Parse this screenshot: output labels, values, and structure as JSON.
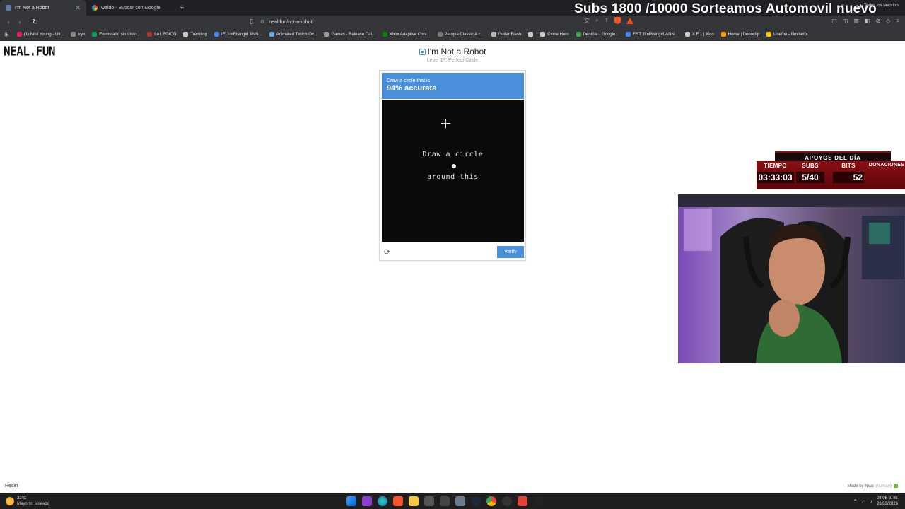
{
  "browser": {
    "tabs": [
      {
        "label": "I'm Not a Robot",
        "active": true
      },
      {
        "label": "waldo - Buscar con Google",
        "active": false
      }
    ],
    "url": "neal.fun/not-a-robot/",
    "bookmarks": [
      {
        "label": "(1) Nihil Young - Ult...",
        "color": "#e91e63"
      },
      {
        "label": "tryn",
        "color": "#888888"
      },
      {
        "label": "Formulario sin título...",
        "color": "#0f9d58"
      },
      {
        "label": "LA LEGION",
        "color": "#aa3333"
      },
      {
        "label": "Trending",
        "color": "#cccccc"
      },
      {
        "label": "IE JimRising#LANN...",
        "color": "#4285f4"
      },
      {
        "label": "Animated Twitch Ov...",
        "color": "#6fa8dc"
      },
      {
        "label": "Games - Release Cal...",
        "color": "#999999"
      },
      {
        "label": "Xbox Adaptive Cont...",
        "color": "#107c10"
      },
      {
        "label": "Petopia Classic A c...",
        "color": "#777777"
      },
      {
        "label": "Guitar Flash",
        "color": "#bbbbbb"
      },
      {
        "label": "",
        "color": "#cccccc"
      },
      {
        "label": "Clone Hero",
        "color": "#cccccc"
      },
      {
        "label": "Dentôfe - Google...",
        "color": "#34a853"
      },
      {
        "label": "EST JimRising#LANN...",
        "color": "#4285f4"
      },
      {
        "label": "X F 1 | Xico",
        "color": "#cccccc"
      },
      {
        "label": "Home | Donoclip",
        "color": "#ff9800"
      },
      {
        "label": "Unefon - Ilimitado",
        "color": "#ffcc00"
      }
    ],
    "all_bookmarks_label": "Todos los favoritos"
  },
  "stream": {
    "title": "Subs 1800 /10000 Sorteamos Automovil nuevo",
    "support_header": "APOYOS DEL DÍA",
    "columns": [
      {
        "label": "TIEMPO",
        "value": "03:33:03"
      },
      {
        "label": "SUBS",
        "value": "5/40"
      },
      {
        "label": "BITS",
        "value": "52"
      },
      {
        "label": "DONACIONES",
        "value": ""
      }
    ]
  },
  "page": {
    "logo": "NEAL.FUN",
    "title": "I'm Not a Robot",
    "subtitle": "Level 17: Perfect Circle",
    "captcha": {
      "instruction_small": "Draw a circle that is",
      "instruction_big": "94% accurate",
      "canvas_line1": "Draw a circle",
      "canvas_line2": "around this",
      "verify_label": "Verify"
    },
    "reset_label": "Reset",
    "madeby_label": "Made by Neal",
    "madeby_muted": "(human)"
  },
  "taskbar": {
    "temperature": "32°C",
    "weather": "Mayorm. soleado",
    "time": "08:05 p. m.",
    "date": "26/03/2026",
    "icons": [
      "windows",
      "app-purple",
      "edge",
      "brave",
      "explorer",
      "app-dark",
      "calc",
      "settings",
      "steam",
      "chrome",
      "media",
      "brave-alt",
      "obs"
    ]
  },
  "colors": {
    "accent": "#4a90d9",
    "overlay_red": "#8b0f14"
  }
}
